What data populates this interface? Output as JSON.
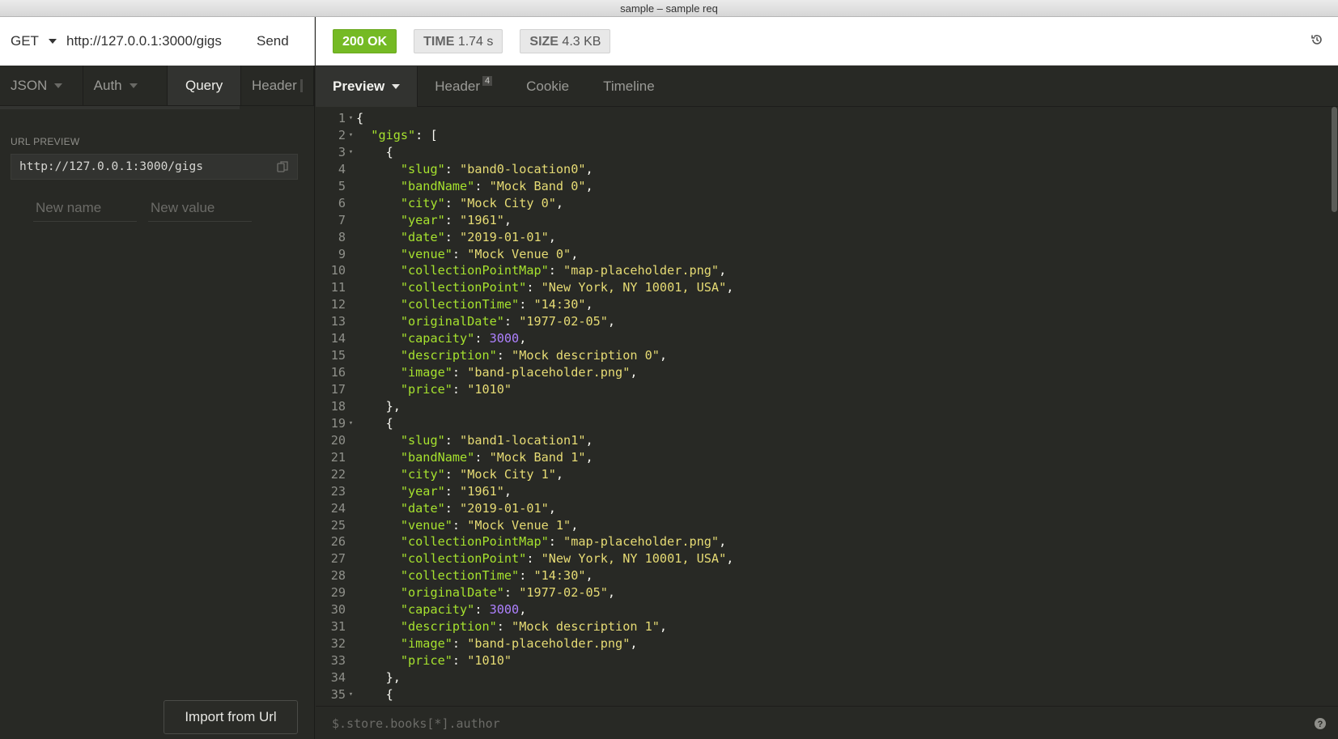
{
  "window": {
    "title": "sample – sample req"
  },
  "request": {
    "method": "GET",
    "url": "http://127.0.0.1:3000/gigs",
    "send_label": "Send"
  },
  "response_status": {
    "status": "200 OK",
    "time_label": "TIME",
    "time_value": "1.74 s",
    "size_label": "SIZE",
    "size_value": "4.3 KB"
  },
  "request_tabs": [
    {
      "label": "JSON",
      "dropdown": true,
      "active": false
    },
    {
      "label": "Auth",
      "dropdown": true,
      "active": false
    },
    {
      "label": "Query",
      "dropdown": false,
      "active": true
    },
    {
      "label": "Header",
      "dropdown": false,
      "active": false
    }
  ],
  "query_panel": {
    "url_preview_label": "URL PREVIEW",
    "url_preview": "http://127.0.0.1:3000/gigs",
    "name_placeholder": "New name",
    "value_placeholder": "New value",
    "import_label": "Import from Url"
  },
  "response_tabs": [
    {
      "label": "Preview",
      "dropdown": true,
      "active": true,
      "count": ""
    },
    {
      "label": "Header",
      "dropdown": false,
      "active": false,
      "count": "4"
    },
    {
      "label": "Cookie",
      "dropdown": false,
      "active": false,
      "count": ""
    },
    {
      "label": "Timeline",
      "dropdown": false,
      "active": false,
      "count": ""
    }
  ],
  "filter": {
    "placeholder": "$.store.books[*].author"
  },
  "code_lines": [
    "{",
    "  \"gigs\": [",
    "    {",
    "      \"slug\": \"band0-location0\",",
    "      \"bandName\": \"Mock Band 0\",",
    "      \"city\": \"Mock City 0\",",
    "      \"year\": \"1961\",",
    "      \"date\": \"2019-01-01\",",
    "      \"venue\": \"Mock Venue 0\",",
    "      \"collectionPointMap\": \"map-placeholder.png\",",
    "      \"collectionPoint\": \"New York, NY 10001, USA\",",
    "      \"collectionTime\": \"14:30\",",
    "      \"originalDate\": \"1977-02-05\",",
    "      \"capacity\": 3000,",
    "      \"description\": \"Mock description 0\",",
    "      \"image\": \"band-placeholder.png\",",
    "      \"price\": \"1010\"",
    "    },",
    "    {",
    "      \"slug\": \"band1-location1\",",
    "      \"bandName\": \"Mock Band 1\",",
    "      \"city\": \"Mock City 1\",",
    "      \"year\": \"1961\",",
    "      \"date\": \"2019-01-01\",",
    "      \"venue\": \"Mock Venue 1\",",
    "      \"collectionPointMap\": \"map-placeholder.png\",",
    "      \"collectionPoint\": \"New York, NY 10001, USA\",",
    "      \"collectionTime\": \"14:30\",",
    "      \"originalDate\": \"1977-02-05\",",
    "      \"capacity\": 3000,",
    "      \"description\": \"Mock description 1\",",
    "      \"image\": \"band-placeholder.png\",",
    "      \"price\": \"1010\"",
    "    },",
    "    {"
  ],
  "foldable_lines": [
    1,
    2,
    3,
    19,
    35
  ],
  "colors": {
    "status_ok": "#75ba24",
    "json_key": "#a6e22e",
    "json_string": "#e6db74",
    "json_number": "#ae81ff",
    "background": "#282925"
  },
  "icons": {
    "history": "history-icon",
    "copy": "copy-icon",
    "help": "help-icon"
  }
}
